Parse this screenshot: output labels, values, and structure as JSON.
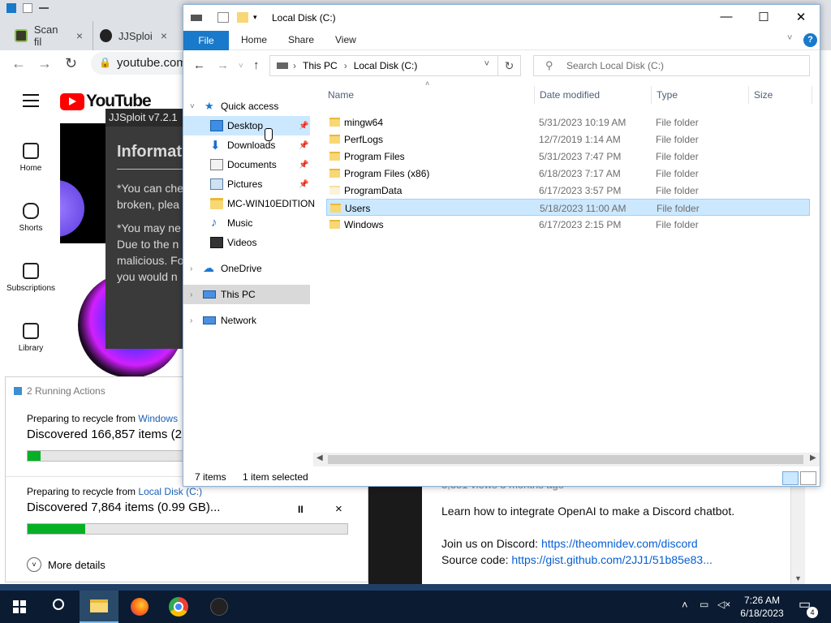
{
  "chrome": {
    "tabs": [
      {
        "label": "Scan fil",
        "close": "×"
      },
      {
        "label": "JJSploi",
        "close": "×"
      }
    ],
    "url": "youtube.com"
  },
  "youtube": {
    "logo": "YouTube",
    "sidebar": [
      {
        "label": "Home",
        "icon": "home-icon"
      },
      {
        "label": "Shorts",
        "icon": "shorts-icon"
      },
      {
        "label": "Subscriptions",
        "icon": "subscriptions-icon"
      },
      {
        "label": "Library",
        "icon": "library-icon"
      }
    ],
    "description": {
      "faded_line": "3,351 views  3 months ago",
      "line1": "Learn how to integrate OpenAI to make a Discord chatbot.",
      "discord_label": "Join us on Discord: ",
      "discord_link": "https://theomnidev.com/discord",
      "source_label": "Source code: ",
      "source_link": "https://gist.github.com/2JJ1/51b85e83..."
    }
  },
  "jjsploit": {
    "title": "JJSploit v7.2.1",
    "heading": "Information",
    "lines": [
      "*You can che",
      "broken, plea",
      "*You may ne",
      "Due to the n",
      "malicious. Fo",
      "you would n"
    ]
  },
  "operations": {
    "header": "2 Running Actions",
    "items": [
      {
        "from_label": "Preparing to recycle from ",
        "from_link": "Windows",
        "discovered": "Discovered 166,857 items (2",
        "progress": 0.04
      },
      {
        "from_label": "Preparing to recycle from ",
        "from_link": "Local Disk (C:)",
        "discovered": "Discovered 7,864 items (0.99 GB)...",
        "progress": 0.18,
        "pause": "II",
        "close": "×"
      }
    ],
    "more_details": "More details"
  },
  "explorer": {
    "title": "Local Disk (C:)",
    "window_buttons": {
      "minimize": "—",
      "maximize": "☐",
      "close": "✕"
    },
    "ribbon": {
      "file": "File",
      "tabs": [
        "Home",
        "Share",
        "View"
      ],
      "help": "?"
    },
    "address": {
      "crumbs": [
        "This PC",
        "Local Disk (C:)"
      ]
    },
    "search_placeholder": "Search Local Disk (C:)",
    "nav": {
      "quick_access": "Quick access",
      "pinned": [
        {
          "label": "Desktop",
          "icon": "desktop-icon"
        },
        {
          "label": "Downloads",
          "icon": "downloads-icon"
        },
        {
          "label": "Documents",
          "icon": "documents-icon"
        },
        {
          "label": "Pictures",
          "icon": "pictures-icon"
        }
      ],
      "recent": [
        {
          "label": "MC-WIN10EDITION",
          "icon": "folder-icon"
        },
        {
          "label": "Music",
          "icon": "music-icon"
        },
        {
          "label": "Videos",
          "icon": "videos-icon"
        }
      ],
      "onedrive": "OneDrive",
      "this_pc": "This PC",
      "network": "Network"
    },
    "columns": [
      "Name",
      "Date modified",
      "Type",
      "Size"
    ],
    "rows": [
      {
        "name": "mingw64",
        "date": "5/31/2023 10:19 AM",
        "type": "File folder"
      },
      {
        "name": "PerfLogs",
        "date": "12/7/2019 1:14 AM",
        "type": "File folder"
      },
      {
        "name": "Program Files",
        "date": "5/31/2023 7:47 PM",
        "type": "File folder"
      },
      {
        "name": "Program Files (x86)",
        "date": "6/18/2023 7:17 AM",
        "type": "File folder"
      },
      {
        "name": "ProgramData",
        "date": "6/17/2023 3:57 PM",
        "type": "File folder"
      },
      {
        "name": "Users",
        "date": "5/18/2023 11:00 AM",
        "type": "File folder",
        "selected": true
      },
      {
        "name": "Windows",
        "date": "6/17/2023 2:15 PM",
        "type": "File folder"
      }
    ],
    "status": {
      "count": "7 items",
      "selected": "1 item selected"
    }
  },
  "taskbar": {
    "apps": [
      "start-button",
      "search-button",
      "file-explorer-button",
      "firefox-button",
      "chrome-button",
      "jjsploit-button"
    ],
    "time": "7:26 AM",
    "date": "6/18/2023",
    "notifications": "4"
  },
  "colors": {
    "accent": "#1979ca",
    "selection": "#cce8ff",
    "progress": "#06b025",
    "yt_red": "#ff0000"
  }
}
